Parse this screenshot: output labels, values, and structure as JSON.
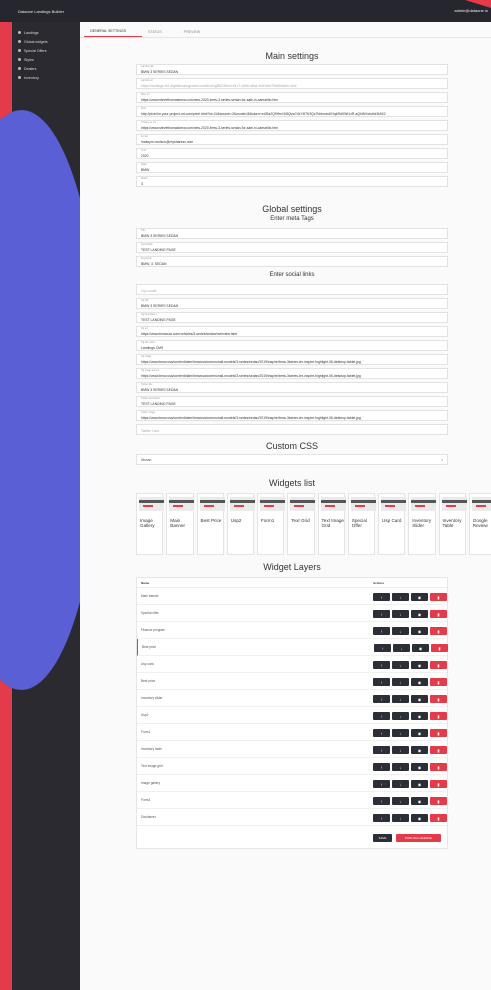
{
  "app": {
    "title": "Dataone Landings Builder",
    "user": "admin@dataone.io"
  },
  "sidebar": {
    "items": [
      {
        "label": "Landings"
      },
      {
        "label": "Global widgets"
      },
      {
        "label": "Special Offers"
      },
      {
        "label": "Styles"
      },
      {
        "label": "Dealers"
      },
      {
        "label": "Inventory"
      }
    ]
  },
  "tabs": [
    {
      "label": "GENERAL SETTINGS"
    },
    {
      "label": "STATUS"
    },
    {
      "label": "PREVIEW"
    }
  ],
  "main_settings": {
    "title": "Main settings",
    "fields": [
      {
        "label": "Landing title",
        "value": "BMW 3 SERIES SEDAN",
        "muted": false
      },
      {
        "label": "Landing url",
        "value": "https://landings.dt1.digitalfusionglobal.com/landing/8523fbe4-b1c7-4d66-a5cd-4b63d6c79b6f/index.html",
        "muted": true
      },
      {
        "label": "Main url",
        "value": "https://www.stevethomasbmw.com/new-2020-bmw-3-series-sedan-for-sale-in-camarillo.htm",
        "muted": false
      },
      {
        "label": "Pixel",
        "value": "http://pixel.lm.your-project-url.com/pixel.html?id=24&source=2&model=8&token=e4f2a2Q9Hm1K8Qvw7d1XH7K3Qz7hbkxow5YtqkRdXWt1zR-aQhWXsfuHd3k5X2",
        "muted": false
      },
      {
        "label": "Thank you url",
        "value": "https://www.stevethomasbmw.com/new-2020-bmw-3-series-sedan-for-sale-in-camarillo.htm",
        "muted": false
      },
      {
        "label": "E-mail",
        "value": "maksym.novikov@mysharesc.com",
        "muted": false
      },
      {
        "label": "Year",
        "value": "2020",
        "muted": false
      },
      {
        "label": "Make",
        "value": "BMW",
        "muted": false
      },
      {
        "label": "Model",
        "value": "3",
        "muted": false
      }
    ]
  },
  "global_settings": {
    "title": "Global settings",
    "meta_subtitle": "Enter meta Tags",
    "meta_fields": [
      {
        "label": "Title",
        "value": "BMW 3 SERIES SEDAN"
      },
      {
        "label": "Description",
        "value": "TEST LANDING PAGE"
      },
      {
        "label": "Keywords",
        "value": "BMW, 3, SEDAN"
      }
    ],
    "social_subtitle": "Enter social links",
    "social_fields": [
      {
        "label": "",
        "value": "",
        "placeholder": "Og Locale"
      },
      {
        "label": "Og title",
        "value": "BMW 3 SERIES SEDAN"
      },
      {
        "label": "Og description",
        "value": "TEST LANDING PAGE"
      },
      {
        "label": "Og url",
        "value": "https://www.bmwusa.com/vehicles/3-series/sedan/overview.html"
      },
      {
        "label": "Og site name",
        "value": "Landings CMS"
      },
      {
        "label": "Og image",
        "value": "https://www.bmw.usa/content/dam/bmwusa/commonall-models/3-series/sedan/2019/inspire/bmw-3series-ter-inspire-highlight-06-desktop-tablet.jpg"
      },
      {
        "label": "Og image secure",
        "value": "https://www.bmw.usa/content/dam/bmwusa/commonall-models/3-series/sedan/2019/inspire/bmw-3series-ter-inspire-highlight-06-desktop-tablet.jpg"
      },
      {
        "label": "Twitter title",
        "value": "BMW 3 SERIES SEDAN"
      },
      {
        "label": "Twitter description",
        "value": "TEST LANDING PAGE"
      },
      {
        "label": "Twitter image",
        "value": "https://www.bmw.usa/content/dam/bmwusa/commonall-models/3-series/sedan/2019/inspire/bmw-3series-ter-inspire-highlight-06-desktop-tablet.jpg"
      },
      {
        "label": "",
        "value": "",
        "placeholder": "Twitter Card"
      }
    ]
  },
  "custom_css": {
    "title": "Custom CSS",
    "selected": "Nissan"
  },
  "widgets_list": {
    "title": "Widgets list",
    "items": [
      {
        "label": "Image Gallery"
      },
      {
        "label": "Main Banner"
      },
      {
        "label": "Best Price"
      },
      {
        "label": "Usp2"
      },
      {
        "label": "Form1"
      },
      {
        "label": "Text Grid"
      },
      {
        "label": "Text Image Grid"
      },
      {
        "label": "Special Offer"
      },
      {
        "label": "Usp Card"
      },
      {
        "label": "Inventory Slider"
      },
      {
        "label": "Inventory Table"
      },
      {
        "label": "Google Review"
      }
    ]
  },
  "widget_layers": {
    "title": "Widget Layers",
    "col_name": "Name",
    "col_actions": "Actions",
    "rows": [
      {
        "name": "Main banner",
        "selected": false
      },
      {
        "name": "Special offer",
        "selected": false
      },
      {
        "name": "Finance program",
        "selected": false
      },
      {
        "name": "Best price",
        "selected": true
      },
      {
        "name": "Usp card",
        "selected": false
      },
      {
        "name": "Best price",
        "selected": false
      },
      {
        "name": "Inventory slider",
        "selected": false
      },
      {
        "name": "Usp2",
        "selected": false
      },
      {
        "name": "Form1",
        "selected": false
      },
      {
        "name": "Inventory table",
        "selected": false
      },
      {
        "name": "Text image grid",
        "selected": false
      },
      {
        "name": "Image gallery",
        "selected": false
      },
      {
        "name": "Form3",
        "selected": false
      },
      {
        "name": "Disclaimer",
        "selected": false
      }
    ],
    "icons": {
      "up": "↑",
      "down": "↓",
      "eye": "◉",
      "trash": "▮"
    },
    "save_label": "SAVE",
    "publish_label": "PUBLISH LANDING"
  },
  "colors": {
    "accent": "#e33b4a",
    "dark": "#2d2f38",
    "blob": "#5a5fd6"
  }
}
